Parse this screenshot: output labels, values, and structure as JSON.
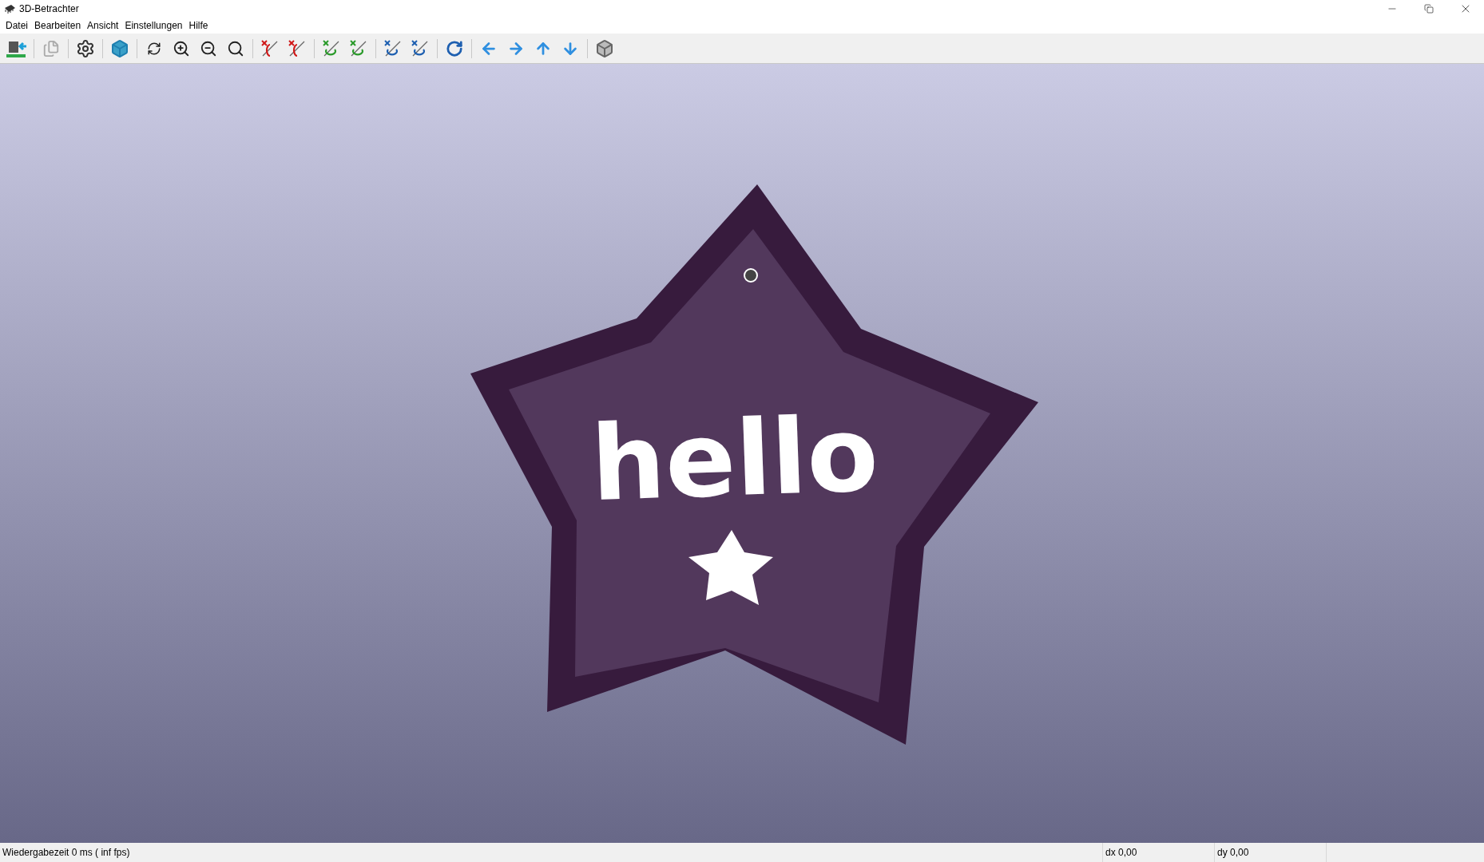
{
  "window": {
    "title": "3D-Betrachter"
  },
  "menu": [
    "Datei",
    "Bearbeiten",
    "Ansicht",
    "Einstellungen",
    "Hilfe"
  ],
  "model": {
    "label": "hello"
  },
  "status_bar": {
    "message": "Wiedergabezeit 0 ms ( inf fps)",
    "dx": "dx 0,00",
    "dy": "dy 0,00"
  }
}
